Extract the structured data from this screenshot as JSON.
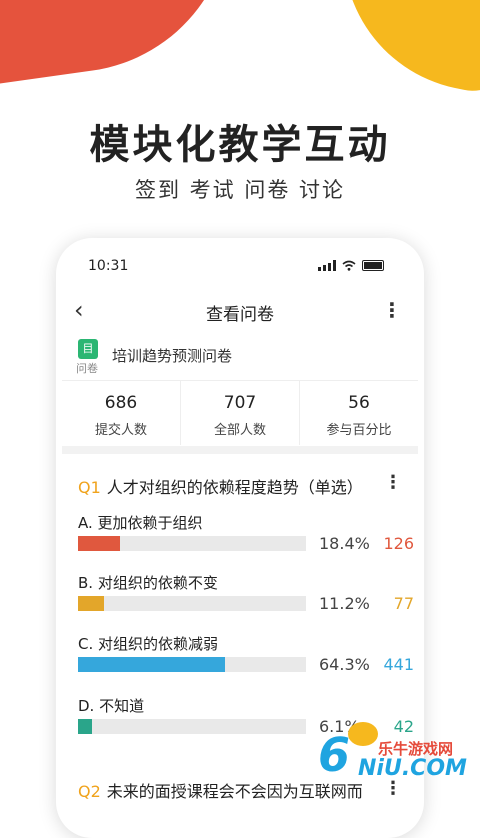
{
  "hero": {
    "headline": "模块化教学互动",
    "subline": "签到 考试 问卷 讨论"
  },
  "status_bar": {
    "time": "10:31"
  },
  "topbar": {
    "title": "查看问卷",
    "back_icon": "‹",
    "more_icon": "⋮"
  },
  "survey": {
    "icon_char": "目",
    "type_label": "问卷",
    "name": "培训趋势预测问卷"
  },
  "stats": [
    {
      "value": "686",
      "label": "提交人数"
    },
    {
      "value": "707",
      "label": "全部人数"
    },
    {
      "value": "56",
      "label": "参与百分比"
    }
  ],
  "questions": [
    {
      "num": "Q1",
      "text": "人才对组织的依赖程度趋势（单选）",
      "options": [
        {
          "label": "A. 更加依赖于组织",
          "percent": "18.4%",
          "count": "126",
          "fraction": 0.184,
          "color": "#e0583e"
        },
        {
          "label": "B. 对组织的依赖不变",
          "percent": "11.2%",
          "count": "77",
          "fraction": 0.112,
          "color": "#e3a62a"
        },
        {
          "label": "C. 对组织的依赖减弱",
          "percent": "64.3%",
          "count": "441",
          "fraction": 0.643,
          "color": "#35a7dc"
        },
        {
          "label": "D. 不知道",
          "percent": "6.1%",
          "count": "42",
          "fraction": 0.061,
          "color": "#2aa58a"
        }
      ]
    },
    {
      "num": "Q2",
      "text": "未来的面授课程会不会因为互联网而"
    }
  ],
  "watermark": {
    "digit": "6",
    "cn": "乐牛游戏网",
    "en": "NiU.COM"
  }
}
